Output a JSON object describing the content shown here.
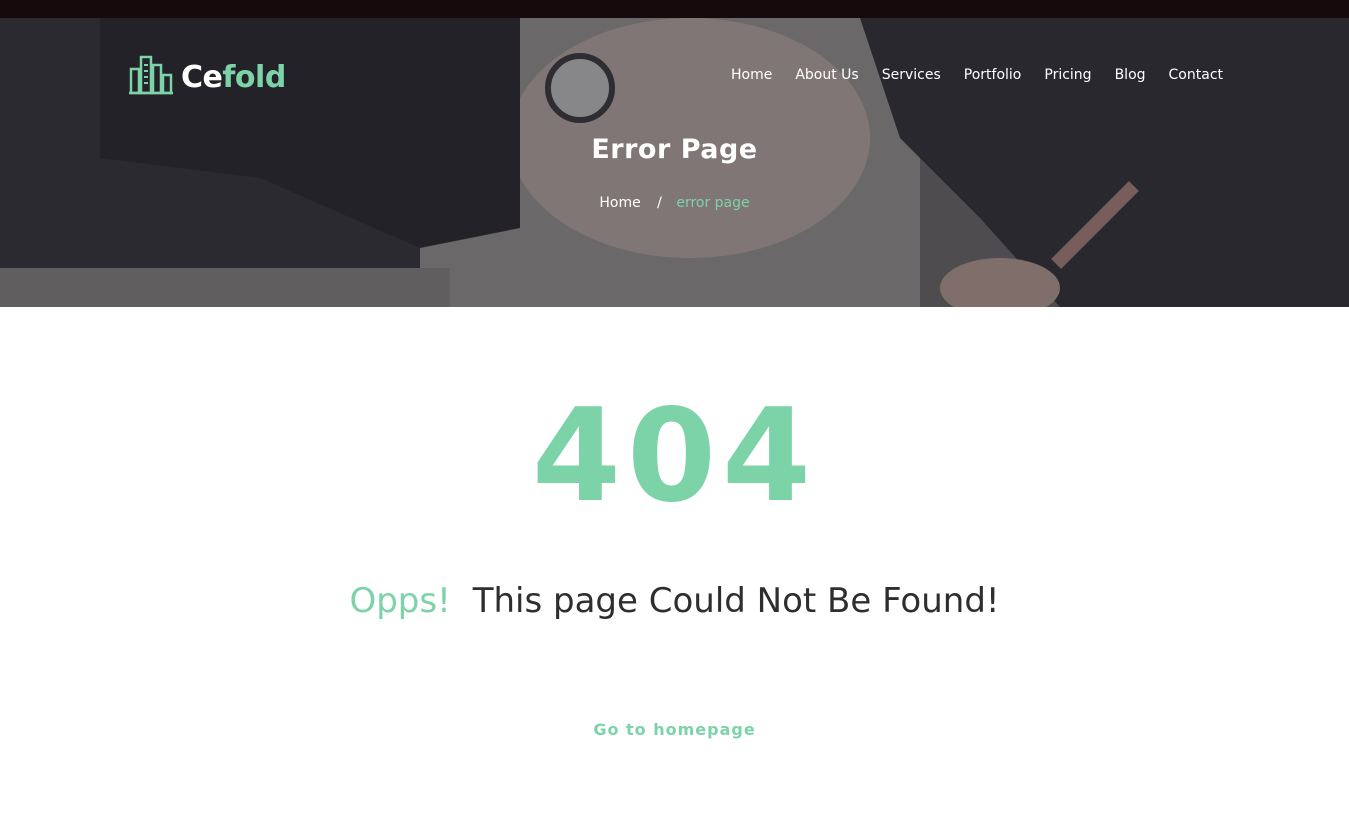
{
  "brand": {
    "name_part1": "Ce",
    "name_part2": "fold",
    "accent": "#7dd3a8"
  },
  "nav": {
    "items": [
      {
        "label": "Home"
      },
      {
        "label": "About Us"
      },
      {
        "label": "Services"
      },
      {
        "label": "Portfolio"
      },
      {
        "label": "Pricing"
      },
      {
        "label": "Blog"
      },
      {
        "label": "Contact"
      }
    ]
  },
  "hero": {
    "title": "Error Page",
    "breadcrumb": {
      "home": "Home",
      "separator": "/",
      "current": "error page"
    }
  },
  "error": {
    "code": "404",
    "headline_accent": "Opps!",
    "headline": "This page Could Not Be Found!",
    "description": "",
    "button_label": "Go to homepage"
  }
}
